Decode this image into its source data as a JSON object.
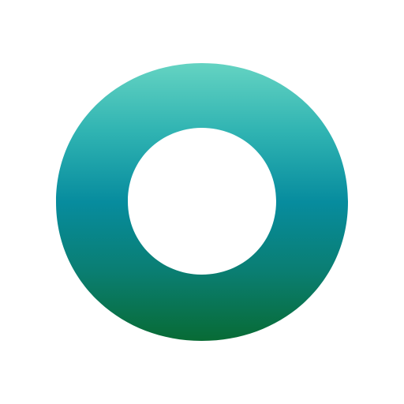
{
  "logo": {
    "icon": "ring-logo-icon",
    "gradient_colors": {
      "top": "#64d3c2",
      "upper_mid": "#2fb3b2",
      "middle": "#078c9e",
      "lower_mid": "#0a7e72",
      "bottom": "#086b35"
    },
    "hole_color": "#ffffff"
  },
  "background_color": "#ffffff"
}
